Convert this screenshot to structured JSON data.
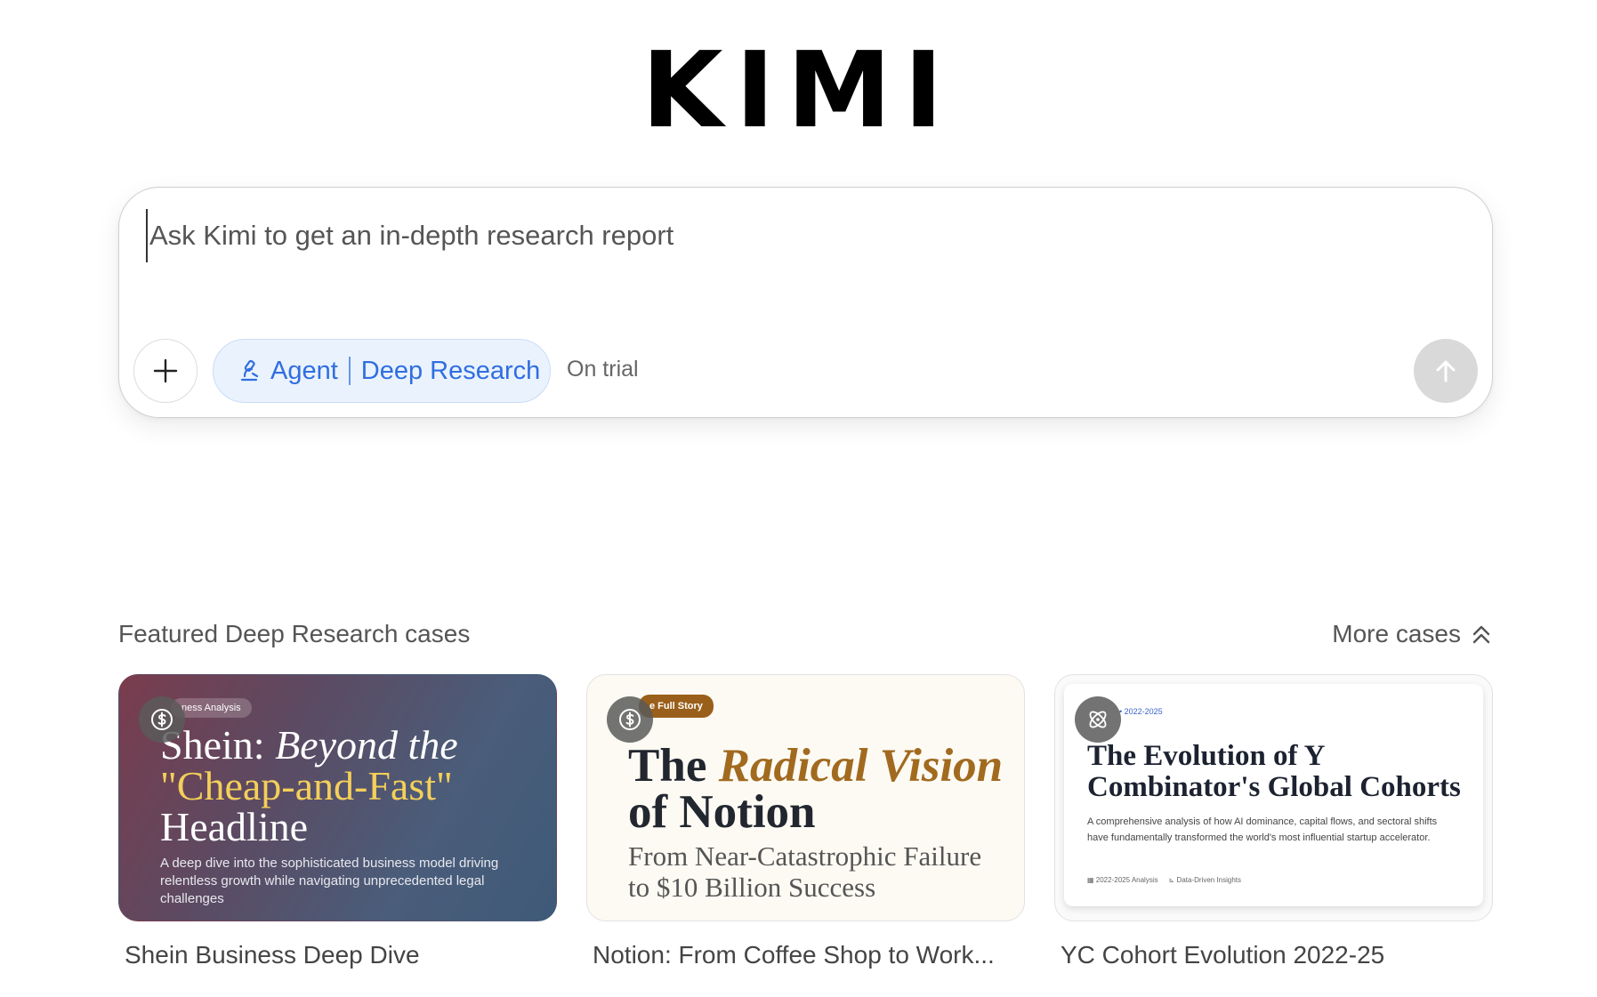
{
  "logo": "KIMI",
  "prompt": {
    "placeholder": "Ask Kimi to get an in-depth research report",
    "value": ""
  },
  "mode": {
    "agent_label": "Agent",
    "mode_label": "Deep Research",
    "trial_label": "On trial"
  },
  "featured": {
    "title": "Featured Deep Research cases",
    "more_label": "More cases"
  },
  "cards": [
    {
      "caption": "Shein Business Deep Dive",
      "icon": "dollar-icon",
      "tag": "ness Analysis",
      "title_plain": "Shein: ",
      "title_italic": "Beyond the",
      "title_highlight": "\"Cheap-and-Fast\"",
      "title_end": "Headline",
      "description": "A deep dive into the sophisticated business model driving relentless growth while navigating unprecedented legal challenges"
    },
    {
      "caption": "Notion: From Coffee Shop to Work...",
      "icon": "dollar-icon",
      "tag": "e Full Story",
      "title_plain": "The ",
      "title_italic": "Radical Vision",
      "title_end": "of Notion",
      "subtitle_1": "From Near-Catastrophic Failure",
      "subtitle_2": "to $10 Billion Success"
    },
    {
      "caption": "YC Cohort Evolution 2022-25",
      "icon": "atom-icon",
      "tag": "• 2022-2025",
      "title_1": "The Evolution of Y",
      "title_2": "Combinator's Global Cohorts",
      "description": "A comprehensive analysis of how AI dominance, capital flows, and sectoral shifts have fundamentally transformed the world's most influential startup accelerator.",
      "meta_1": "2022-2025 Analysis",
      "meta_2": "Data-Driven Insights"
    }
  ],
  "colors": {
    "accent": "#2f6ee0",
    "pill_bg": "#eaf2fd",
    "send_disabled": "#d9d9d9",
    "gold": "#a16a1f",
    "yellow": "#f4cf5a"
  }
}
